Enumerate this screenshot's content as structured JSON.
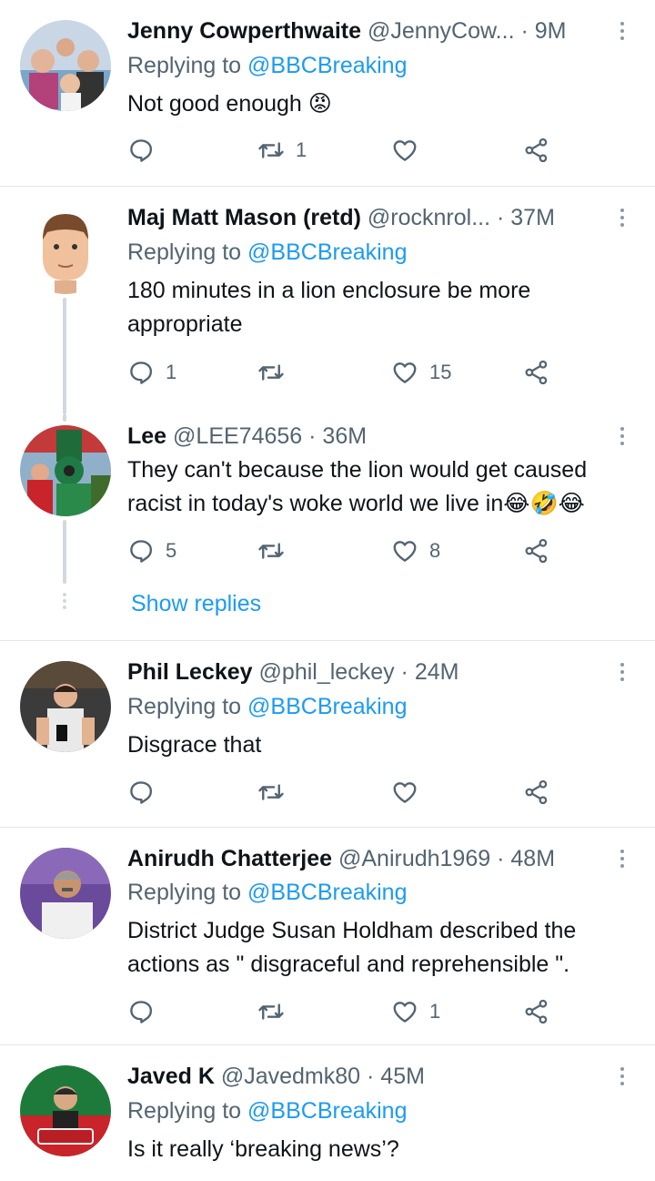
{
  "icons": {
    "reply": "reply-icon",
    "retweet": "retweet-icon",
    "like": "like-icon",
    "share": "share-icon",
    "more": "more-options-icon"
  },
  "colors": {
    "link": "#1d9bf0",
    "muted": "#536471",
    "text": "#0f1419",
    "divider": "#e3e6e8"
  },
  "tweets": [
    {
      "name": "Jenny Cowperthwaite",
      "handle": "@JennyCow...",
      "time": "· 9M",
      "reply_prefix": "Replying to ",
      "reply_to": "@BBCBreaking",
      "text": "Not good enough 😡",
      "replies": "",
      "retweets": "1",
      "likes": ""
    },
    {
      "name": "Maj Matt Mason (retd)",
      "handle": "@rocknrol...",
      "time": "· 37M",
      "reply_prefix": "Replying to ",
      "reply_to": "@BBCBreaking",
      "text": "180 minutes in a lion enclosure be more appropriate",
      "replies": "1",
      "retweets": "",
      "likes": "15"
    },
    {
      "name": "Lee",
      "handle": "@LEE74656",
      "time": "· 36M",
      "text": "They can't because the lion would get caused racist in today's woke world we live in😂🤣😂",
      "replies": "5",
      "retweets": "",
      "likes": "8",
      "show_replies": "Show replies"
    },
    {
      "name": "Phil Leckey",
      "handle": "@phil_leckey",
      "time": "· 24M",
      "reply_prefix": "Replying to ",
      "reply_to": "@BBCBreaking",
      "text": "Disgrace that",
      "replies": "",
      "retweets": "",
      "likes": ""
    },
    {
      "name": "Anirudh Chatterjee",
      "handle": "@Anirudh1969",
      "time": "· 48M",
      "reply_prefix": "Replying to ",
      "reply_to": "@BBCBreaking",
      "text": "District Judge Susan Holdham  described the actions as  \" disgraceful and reprehensible \".",
      "replies": "",
      "retweets": "",
      "likes": "1"
    },
    {
      "name": "Javed K",
      "handle": "@Javedmk80",
      "time": "· 45M",
      "reply_prefix": "Replying to ",
      "reply_to": "@BBCBreaking",
      "text": "Is it really ‘breaking news’?"
    }
  ]
}
